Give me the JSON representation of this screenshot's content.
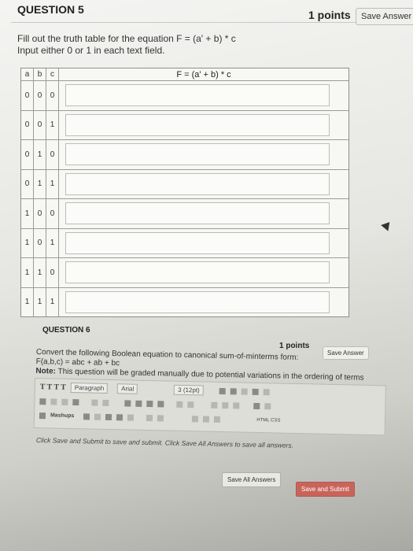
{
  "question5": {
    "title": "QUESTION 5",
    "points": "1 points",
    "save_label": "Save Answer",
    "prompt_line1": "Fill out the truth table for the equation F = (a' + b) * c",
    "prompt_line2": "Input either 0 or 1 in each text field.",
    "table": {
      "headers": [
        "a",
        "b",
        "c"
      ],
      "f_header": "F = (a' + b) * c",
      "rows": [
        [
          "0",
          "0",
          "0"
        ],
        [
          "0",
          "0",
          "1"
        ],
        [
          "0",
          "1",
          "0"
        ],
        [
          "0",
          "1",
          "1"
        ],
        [
          "1",
          "0",
          "0"
        ],
        [
          "1",
          "0",
          "1"
        ],
        [
          "1",
          "1",
          "0"
        ],
        [
          "1",
          "1",
          "1"
        ]
      ]
    }
  },
  "question6": {
    "title": "QUESTION 6",
    "points": "1 points",
    "save_label": "Save Answer",
    "line1": "Convert the following Boolean equation to canonical sum-of-minterms form:",
    "line2": "F(a,b,c) = abc + ab + bc",
    "note_label": "Note:",
    "note_text": " This question will be graded manually due to potential variations in the ordering of terms",
    "editor": {
      "style_label": "T T T T",
      "paragraph": "Paragraph",
      "font": "Arial",
      "size": "3 (12pt)",
      "mashups": "Mashups",
      "html_label": "HTML CSS"
    }
  },
  "footer": {
    "hint": "Click Save and Submit to save and submit. Click Save All Answers to save all answers.",
    "save_all": "Save All Answers",
    "save_submit": "Save and Submit"
  }
}
